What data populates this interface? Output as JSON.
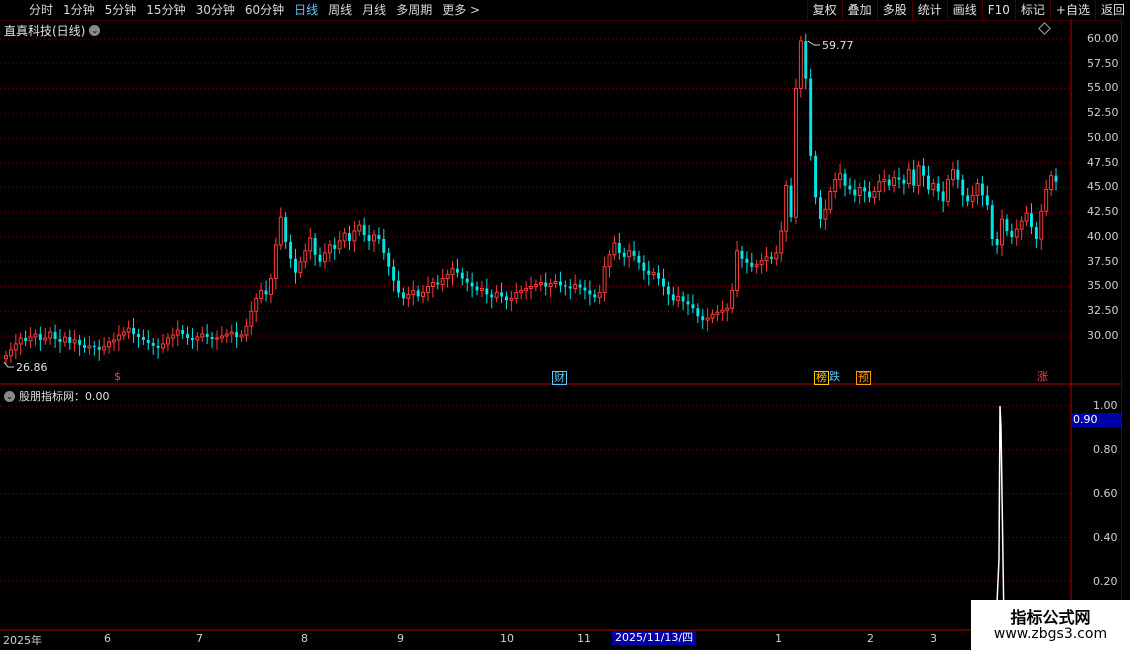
{
  "toolbar": {
    "periods": [
      "分时",
      "1分钟",
      "5分钟",
      "15分钟",
      "30分钟",
      "60分钟",
      "日线",
      "周线",
      "月线",
      "多周期",
      "更多 >"
    ],
    "active_period": "日线",
    "tools": [
      "复权",
      "叠加",
      "多股",
      "统计",
      "画线",
      "F10",
      "标记",
      "+自选",
      "返回"
    ]
  },
  "main_chart": {
    "title": "直真科技(日线)",
    "y_ticks": [
      "60.00",
      "57.50",
      "55.00",
      "52.50",
      "50.00",
      "47.50",
      "45.00",
      "42.50",
      "40.00",
      "37.50",
      "35.00",
      "32.50",
      "30.00"
    ],
    "high_label": "59.77",
    "low_label": "26.86",
    "event_tags": [
      {
        "text": "$",
        "color": "#ff4040"
      },
      {
        "text": "财",
        "color": "#5ac8ff"
      },
      {
        "text": "榜",
        "color": "#ffcc00"
      },
      {
        "text": "跌",
        "color": "#5ac8ff"
      },
      {
        "text": "预",
        "color": "#ff9900"
      },
      {
        "text": "涨",
        "color": "#ff4040"
      }
    ]
  },
  "sub_chart": {
    "title": "股朋指标网：0.00",
    "y_ticks": [
      "1.00",
      "0.80",
      "0.60",
      "0.40",
      "0.20"
    ],
    "current_value": "0.90"
  },
  "date_axis": {
    "labels": [
      "2025年",
      "6",
      "7",
      "8",
      "9",
      "10",
      "11",
      "1",
      "2",
      "3"
    ],
    "highlight": "2025/11/13/四"
  },
  "watermark": {
    "line1": "指标公式网",
    "line2": "www.zbgs3.com"
  },
  "colors": {
    "up": "#ff3b3b",
    "down": "#00e5e5",
    "grid": "#7a0000",
    "axis": "#b00000",
    "highlight": "#0000a8"
  },
  "chart_data": {
    "type": "candlestick",
    "title": "直真科技(日线)",
    "ylim": [
      26.5,
      60.5
    ],
    "y_ticks": [
      30,
      32.5,
      35,
      37.5,
      40,
      42.5,
      45,
      47.5,
      50,
      52.5,
      55,
      57.5,
      60
    ],
    "max_label": 59.77,
    "min_label": 26.86,
    "close_series": [
      28.0,
      28.6,
      29.2,
      29.8,
      29.5,
      29.9,
      30.2,
      29.6,
      29.8,
      30.4,
      29.7,
      29.4,
      29.9,
      29.3,
      29.6,
      29.1,
      28.8,
      29.0,
      28.9,
      28.6,
      28.9,
      29.4,
      29.6,
      30.1,
      30.4,
      30.8,
      30.2,
      29.9,
      29.6,
      29.3,
      29.0,
      28.8,
      29.2,
      29.8,
      30.1,
      30.6,
      30.2,
      29.8,
      29.6,
      29.9,
      30.2,
      29.9,
      29.7,
      29.8,
      30.0,
      30.2,
      30.4,
      29.9,
      30.1,
      31.0,
      32.5,
      33.8,
      34.6,
      34.2,
      35.8,
      39.2,
      42.0,
      39.5,
      37.8,
      36.4,
      37.5,
      38.6,
      39.9,
      38.2,
      37.5,
      38.4,
      39.2,
      38.8,
      39.6,
      40.4,
      39.6,
      40.6,
      41.2,
      40.2,
      39.6,
      40.2,
      39.8,
      38.4,
      37.0,
      35.6,
      34.4,
      33.8,
      34.2,
      34.6,
      34.0,
      34.4,
      35.0,
      35.4,
      35.2,
      35.8,
      36.2,
      36.8,
      36.4,
      35.8,
      35.4,
      35.0,
      34.6,
      34.8,
      34.2,
      33.9,
      34.4,
      34.0,
      33.6,
      33.8,
      34.4,
      34.6,
      34.8,
      35.0,
      35.2,
      35.4,
      35.0,
      35.3,
      35.5,
      35.1,
      35.0,
      34.8,
      35.2,
      34.9,
      34.6,
      34.2,
      33.9,
      34.4,
      37.0,
      38.2,
      39.4,
      38.4,
      38.0,
      38.6,
      38.1,
      37.4,
      36.6,
      36.2,
      36.4,
      35.8,
      35.0,
      34.2,
      33.6,
      34.0,
      33.5,
      33.2,
      32.8,
      32.0,
      31.6,
      31.8,
      32.2,
      32.4,
      32.6,
      32.8,
      34.6,
      38.6,
      37.8,
      37.4,
      37.0,
      37.2,
      37.6,
      38.0,
      37.8,
      38.4,
      40.6,
      45.2,
      42.0,
      55.0,
      59.8,
      56.0,
      48.2,
      44.0,
      41.8,
      42.8,
      44.6,
      45.8,
      46.4,
      45.2,
      44.8,
      44.2,
      45.0,
      44.6,
      44.0,
      44.6,
      45.6,
      45.8,
      45.2,
      46.0,
      45.8,
      45.4,
      46.8,
      45.2,
      47.2,
      46.2,
      44.8,
      45.4,
      44.6,
      43.6,
      45.8,
      46.8,
      45.8,
      44.2,
      43.6,
      44.2,
      45.4,
      44.2,
      43.2,
      39.8,
      39.2,
      41.8,
      40.6,
      40.0,
      40.8,
      41.6,
      42.4,
      41.0,
      39.8,
      42.6,
      44.8,
      46.2,
      45.6
    ]
  },
  "sub_chart_data": {
    "type": "line",
    "ylim": [
      0,
      1.05
    ],
    "y_ticks": [
      1.0,
      0.8,
      0.6,
      0.4,
      0.2
    ],
    "spike_value": 1.0,
    "current_value": 0.9
  }
}
